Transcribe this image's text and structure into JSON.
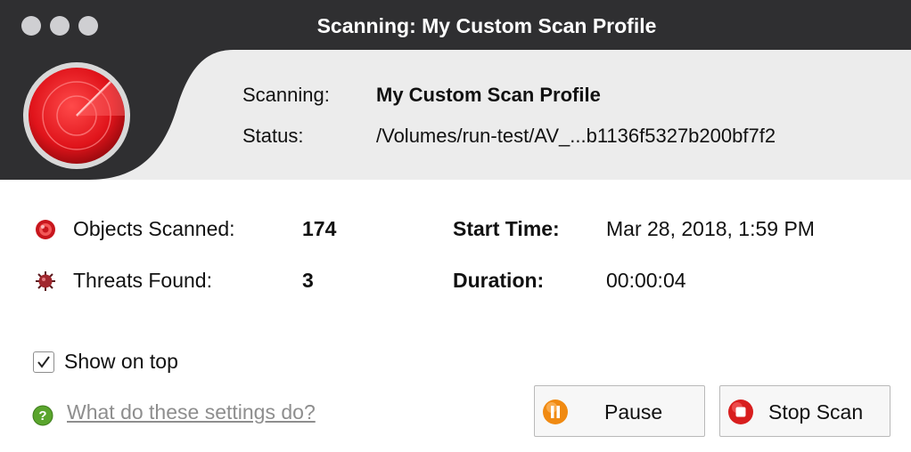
{
  "window": {
    "title": "Scanning: My Custom Scan Profile"
  },
  "header": {
    "scanning_label": "Scanning:",
    "scanning_value": "My Custom Scan Profile",
    "status_label": "Status:",
    "status_value": "/Volumes/run-test/AV_...b1136f5327b200bf7f2"
  },
  "stats": {
    "objects_scanned_label": "Objects Scanned:",
    "objects_scanned_value": "174",
    "threats_found_label": "Threats Found:",
    "threats_found_value": "3",
    "start_time_label": "Start Time:",
    "start_time_value": "Mar 28, 2018, 1:59 PM",
    "duration_label": "Duration:",
    "duration_value": "00:00:04"
  },
  "options": {
    "show_on_top_label": "Show on top",
    "show_on_top_checked": true,
    "help_link": "What do these settings do?"
  },
  "buttons": {
    "pause_label": "Pause",
    "stop_label": "Stop Scan"
  },
  "colors": {
    "titlebar": "#2f2f31",
    "header_bg": "#ececec",
    "radar_red": "#e0141b",
    "pause_orange": "#f08a12",
    "stop_red": "#d81e1e",
    "help_green": "#5aa52d"
  },
  "icons": {
    "radar": "radar-icon",
    "objects": "target-icon",
    "threats": "virus-icon",
    "help": "help-icon",
    "pause": "pause-icon",
    "stop": "stop-icon"
  }
}
